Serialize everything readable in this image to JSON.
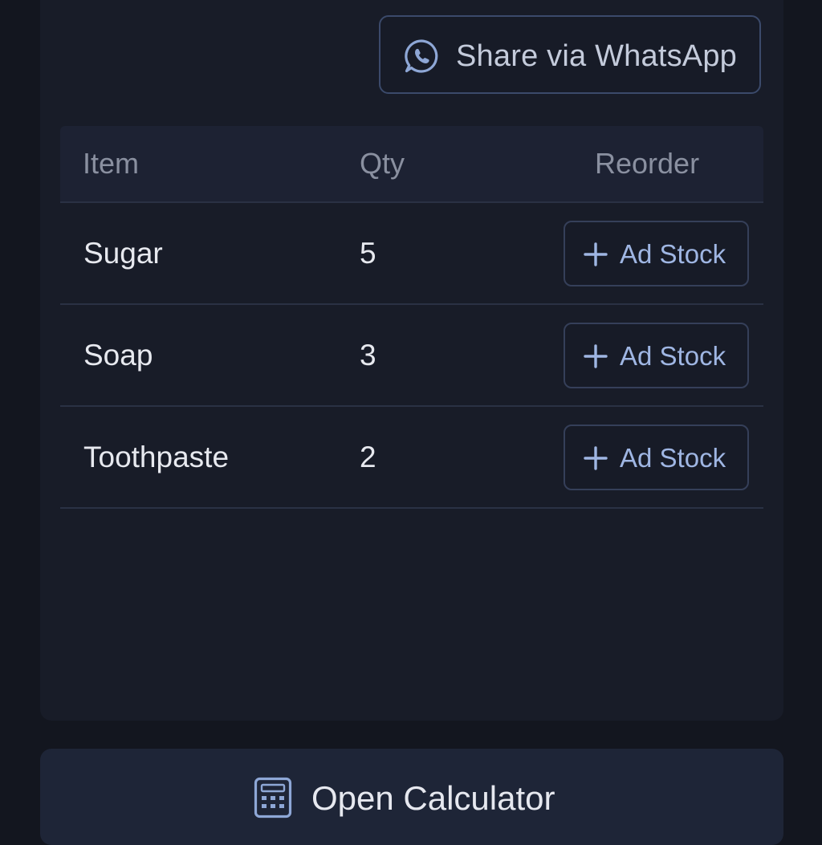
{
  "share": {
    "label": "Share via WhatsApp",
    "icon": "whatsapp-icon"
  },
  "table": {
    "headers": {
      "item": "Item",
      "qty": "Qty",
      "reorder": "Reorder"
    },
    "rows": [
      {
        "item": "Sugar",
        "qty": "5",
        "action": "Ad Stock"
      },
      {
        "item": "Soap",
        "qty": "3",
        "action": "Ad Stock"
      },
      {
        "item": "Toothpaste",
        "qty": "2",
        "action": "Ad Stock"
      }
    ]
  },
  "calculator": {
    "label": "Open Calculator",
    "icon": "calculator-icon"
  },
  "colors": {
    "background": "#13161f",
    "card": "#181c28",
    "accent": "#9fb6e3",
    "border": "#3b4a6b"
  }
}
